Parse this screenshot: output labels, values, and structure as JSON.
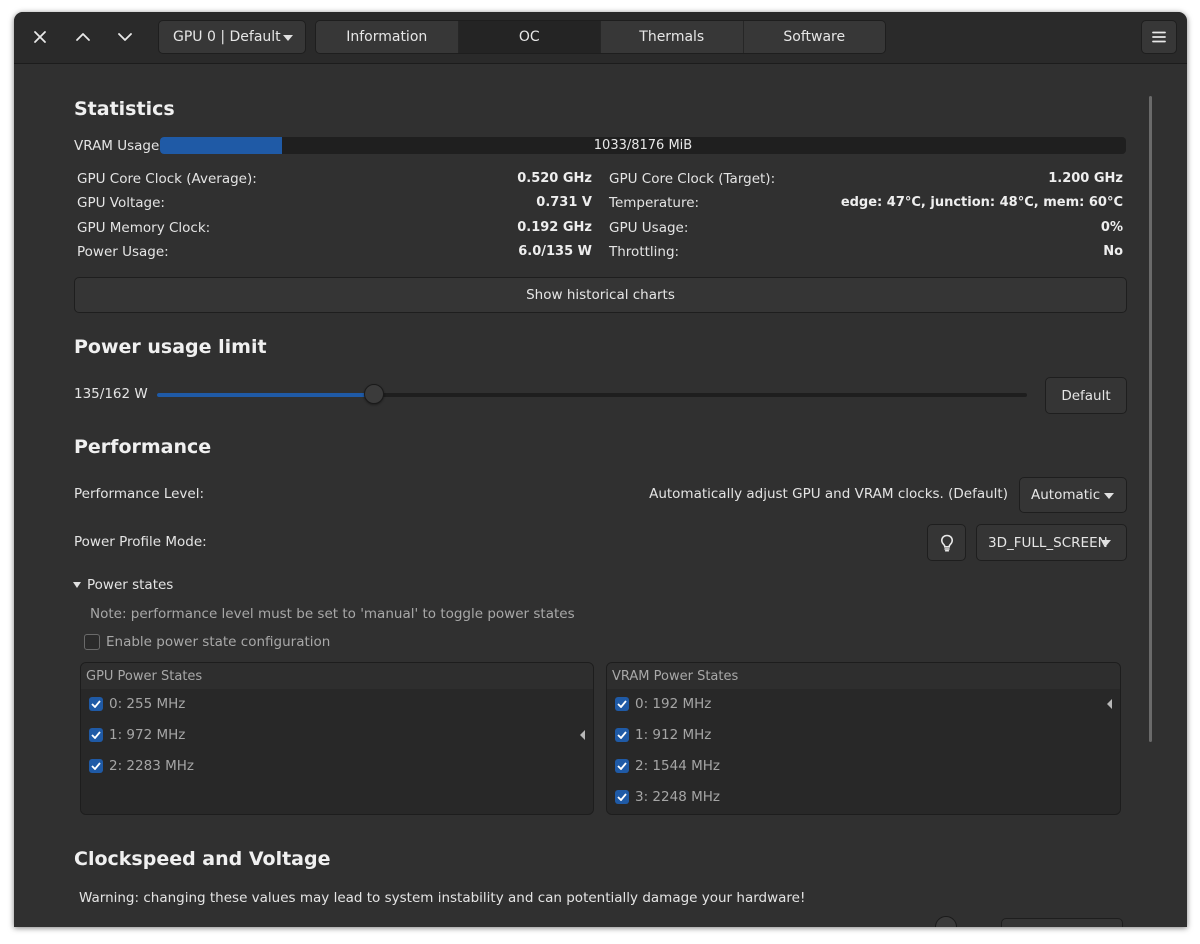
{
  "header": {
    "gpu_selector": "GPU 0 | Default",
    "tabs": [
      {
        "label": "Information",
        "active": false
      },
      {
        "label": "OC",
        "active": true
      },
      {
        "label": "Thermals",
        "active": false
      },
      {
        "label": "Software",
        "active": false
      }
    ],
    "icons": {
      "close": "close-icon",
      "up": "chevron-up-icon",
      "down": "chevron-down-icon",
      "menu": "hamburger-menu-icon"
    }
  },
  "statistics": {
    "title": "Statistics",
    "vram_label": "VRAM Usage:",
    "vram_text": "1033/8176 MiB",
    "vram_used": 1033,
    "vram_total": 8176,
    "left": [
      {
        "label": "GPU Core Clock (Average):",
        "value": "0.520 GHz"
      },
      {
        "label": "GPU Voltage:",
        "value": "0.731 V"
      },
      {
        "label": "GPU Memory Clock:",
        "value": "0.192 GHz"
      },
      {
        "label": "Power Usage:",
        "value": "6.0/135 W"
      }
    ],
    "right": [
      {
        "label": "GPU Core Clock (Target):",
        "value": "1.200 GHz"
      },
      {
        "label": "Temperature:",
        "value": "edge: 47°C, junction: 48°C, mem: 60°C"
      },
      {
        "label": "GPU Usage:",
        "value": "0%"
      },
      {
        "label": "Throttling:",
        "value": "No"
      }
    ],
    "charts_button": "Show historical charts"
  },
  "power_limit": {
    "title": "Power usage limit",
    "value_text": "135/162 W",
    "current": 135,
    "max": 162,
    "default_button": "Default"
  },
  "performance": {
    "title": "Performance",
    "level_label": "Performance Level:",
    "level_description": "Automatically adjust GPU and VRAM clocks. (Default)",
    "level_value": "Automatic",
    "profile_label": "Power Profile Mode:",
    "profile_value": "3D_FULL_SCREEN",
    "power_states_label": "Power states",
    "note": "Note: performance level must be set to 'manual' to toggle power states",
    "enable_label": "Enable power state configuration",
    "gpu_states": {
      "title": "GPU Power States",
      "items": [
        "0: 255 MHz",
        "1: 972 MHz",
        "2: 2283 MHz"
      ]
    },
    "vram_states": {
      "title": "VRAM Power States",
      "items": [
        "0: 192 MHz",
        "1: 912 MHz",
        "2: 1544 MHz",
        "3: 2248 MHz"
      ]
    }
  },
  "clockspeed": {
    "title": "Clockspeed and Voltage",
    "warning": "Warning: changing these values may lead to system instability and can potentially damage your hardware!"
  },
  "colors": {
    "accent": "#1f5aa6",
    "background": "#303030",
    "header": "#2a2a2a"
  }
}
